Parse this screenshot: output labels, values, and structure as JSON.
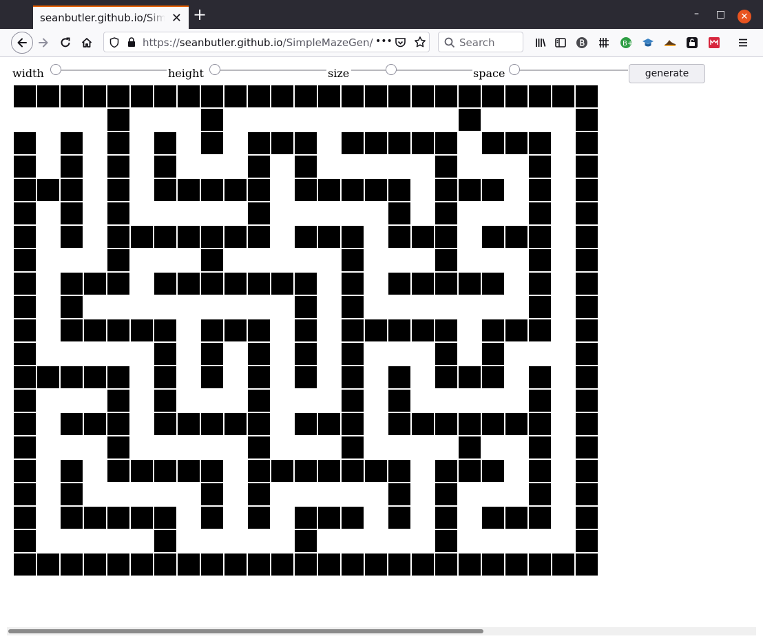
{
  "browser": {
    "tab_title": "seanbutler.github.io/SimpleMazeGen/",
    "tab_close": "✕",
    "new_tab": "+",
    "url_scheme": "https://",
    "url_host": "seanbutler.github.io",
    "url_path": "/SimpleMazeGen/",
    "search_placeholder": "Search",
    "page_actions": "•••",
    "window_buttons": {
      "minimize": "–",
      "maximize": "□",
      "close": "✕"
    }
  },
  "controls": {
    "width_label": "width",
    "height_label": "height",
    "size_label": "size",
    "space_label": "space",
    "generate_label": "generate"
  },
  "maze": {
    "rows": [
      "1111111111111111111111111",
      "0000100010000000000100001",
      "1010101010111011111011101",
      "1010101000101000001000101",
      "1110101111101111101110101",
      "1010100000100000101000101",
      "1010111111101110111011101",
      "1000100010000010001000101",
      "1011101111111010111110101",
      "1010000000001010000000101",
      "1011111011101011111011101",
      "1000001010101010001010001",
      "1111101010101010101110101",
      "1000101000100010100000101",
      "1011101111101110111111101",
      "1000100000100010000100101",
      "1010111110111111101110101",
      "1010000010100000101000101",
      "1011111010101110101011101",
      "1000001000001000001000001",
      "1111111111111111111111111"
    ],
    "wall_color": "#000000",
    "path_color": "#ffffff"
  }
}
